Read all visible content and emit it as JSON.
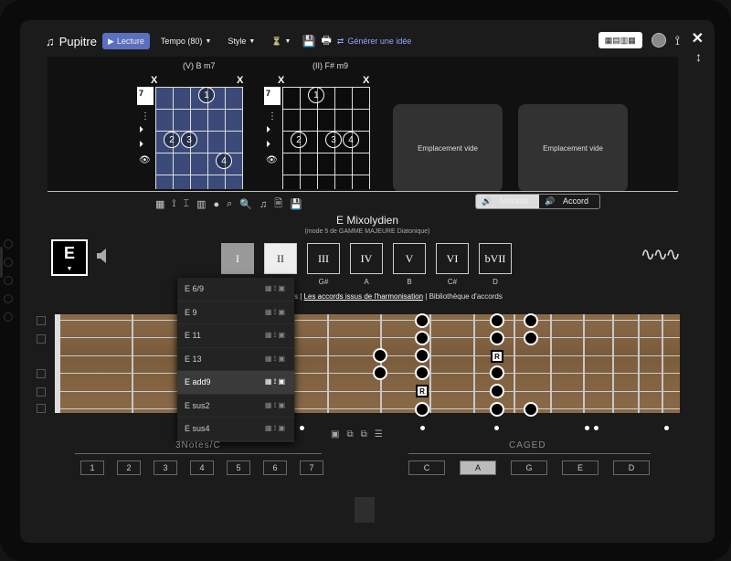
{
  "toolbar": {
    "app_name": "Pupitre",
    "lecture_label": "Lecture",
    "tempo_label": "Tempo (80)",
    "style_label": "Style",
    "generate_label": "Générer une idée"
  },
  "chords": {
    "chord1_title": "(V) B m7",
    "chord1_fret": "7",
    "chord2_title": "(II) F# m9",
    "chord2_fret": "7",
    "chord1_fingers": [
      "1",
      "2",
      "3",
      "4"
    ],
    "chord2_fingers": [
      "1",
      "2",
      "3",
      "4"
    ],
    "empty_slot_1": "Emplacement vide",
    "empty_slot_2": "Emplacement vide"
  },
  "playback_mode": {
    "melodie": "Mélodie",
    "accord": "Accord",
    "selected": "melodie"
  },
  "scale": {
    "title": "E Mixolydien",
    "subtitle": "(mode 5 de GAMME MAJEURE Diatonique)",
    "key": "E"
  },
  "degrees": [
    {
      "label": "I",
      "note": ""
    },
    {
      "label": "II",
      "note": ""
    },
    {
      "label": "III",
      "note": "G#"
    },
    {
      "label": "IV",
      "note": "A"
    },
    {
      "label": "V",
      "note": "B"
    },
    {
      "label": "VI",
      "note": "C#"
    },
    {
      "label": "bVII",
      "note": "D"
    }
  ],
  "links": {
    "partial": "lles |",
    "harmonisation": "Les accords issus de l'harmonisation",
    "sep": "|",
    "library": "Bibliothèque d'accords"
  },
  "dropdown": {
    "items": [
      "E 6/9",
      "E 9",
      "E 11",
      "E 13",
      "E add9",
      "E sus2",
      "E sus4"
    ],
    "selected": "E add9"
  },
  "groups": {
    "notes_title": "3Notes/C",
    "notes_buttons": [
      "1",
      "2",
      "3",
      "4",
      "5",
      "6",
      "7"
    ],
    "caged_title": "CAGED",
    "caged_buttons": [
      "C",
      "A",
      "G",
      "E",
      "D"
    ],
    "caged_selected": "A"
  },
  "fretboard": {
    "root_marker": "R"
  }
}
